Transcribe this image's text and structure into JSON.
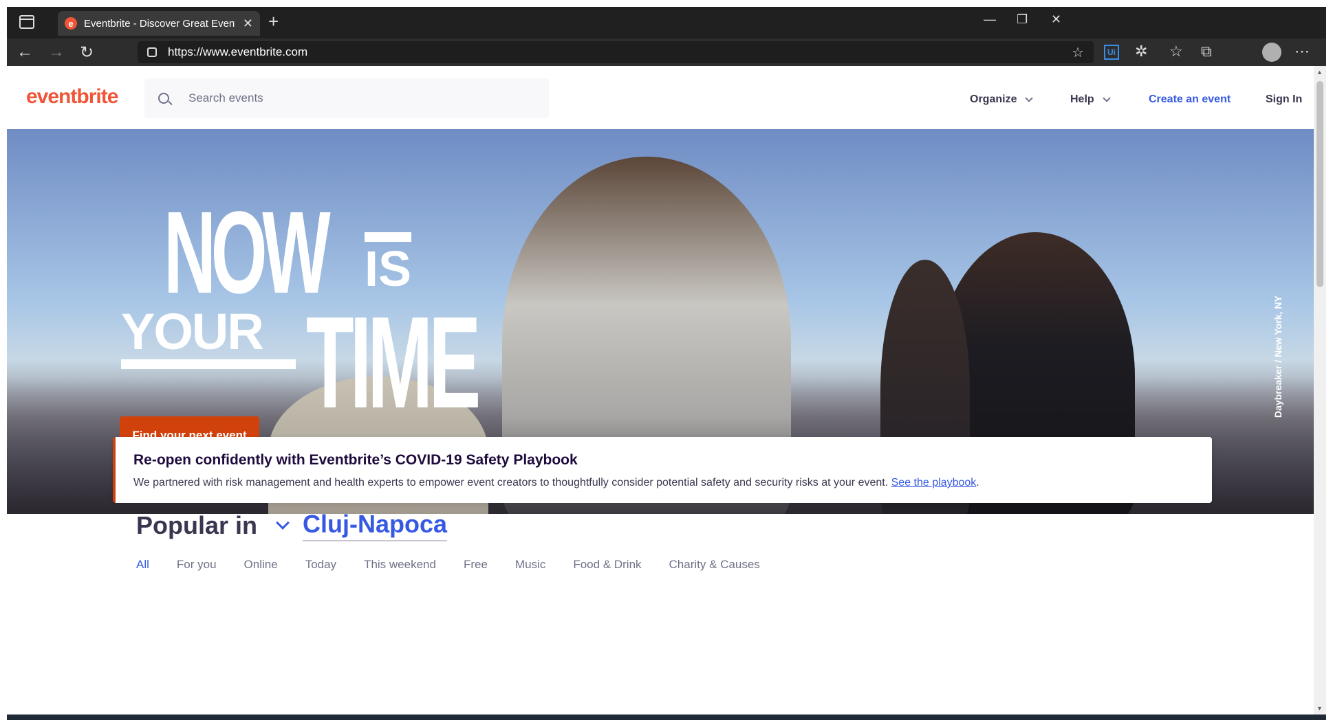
{
  "browser": {
    "tab_title": "Eventbrite - Discover Great Events",
    "tab_favicon": "e",
    "url": "https://www.eventbrite.com",
    "new_tab_symbol": "+",
    "close_symbol": "✕"
  },
  "header": {
    "logo": "eventbrite",
    "search_placeholder": "Search events",
    "organize": "Organize",
    "help": "Help",
    "create_event": "Create an event",
    "sign_in": "Sign In"
  },
  "hero": {
    "line1": "NOW",
    "line1b": "IS",
    "line2": "YOUR",
    "line3": "TIME",
    "cta": "Find your next event",
    "credit": "Daybreaker / New York, NY"
  },
  "notice": {
    "title": "Re-open confidently with Eventbrite’s COVID-19 Safety Playbook",
    "body": "We partnered with risk management and health experts to empower event creators to thoughtfully consider potential safety and security risks at your event.",
    "link": "See the playbook",
    "period": "."
  },
  "popular": {
    "label": "Popular in",
    "city": "Cluj-Napoca"
  },
  "filters": [
    "All",
    "For you",
    "Online",
    "Today",
    "This weekend",
    "Free",
    "Music",
    "Food & Drink",
    "Charity & Causes"
  ],
  "colors": {
    "brand": "#f05537",
    "cta": "#d1410c",
    "link": "#3659e3",
    "text": "#39364f"
  }
}
